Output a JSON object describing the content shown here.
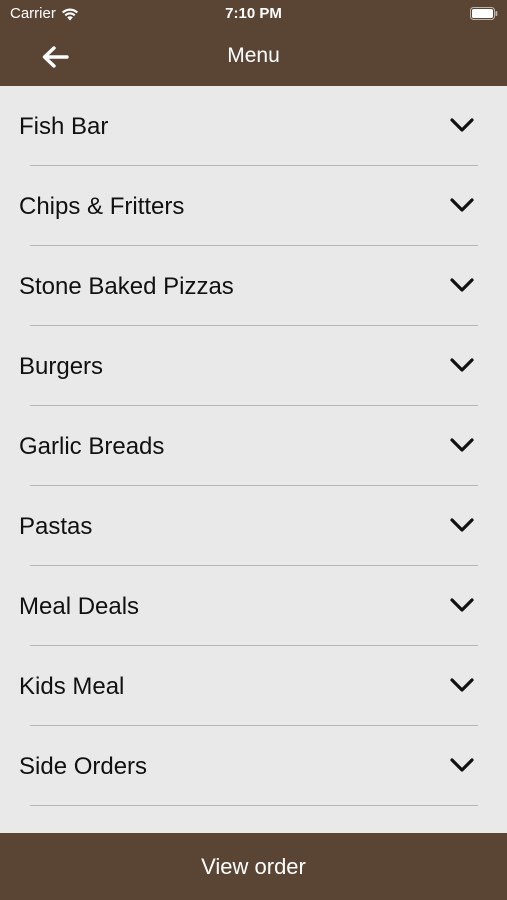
{
  "status_bar": {
    "carrier": "Carrier",
    "time": "7:10 PM",
    "wifi_icon": "wifi-icon",
    "battery_icon": "battery-icon"
  },
  "nav": {
    "title": "Menu",
    "back_icon": "arrow-left-icon"
  },
  "menu": {
    "items": [
      {
        "label": "Fish Bar"
      },
      {
        "label": "Chips & Fritters"
      },
      {
        "label": "Stone Baked Pizzas"
      },
      {
        "label": "Burgers"
      },
      {
        "label": "Garlic Breads"
      },
      {
        "label": "Pastas"
      },
      {
        "label": "Meal Deals"
      },
      {
        "label": "Kids Meal"
      },
      {
        "label": "Side Orders"
      }
    ],
    "chevron_icon": "chevron-down-icon"
  },
  "footer": {
    "view_order_label": "View order"
  },
  "colors": {
    "header_bg": "#5a4535",
    "list_bg": "#e9e9e9",
    "divider": "#b5b5b5",
    "text": "#111111"
  }
}
